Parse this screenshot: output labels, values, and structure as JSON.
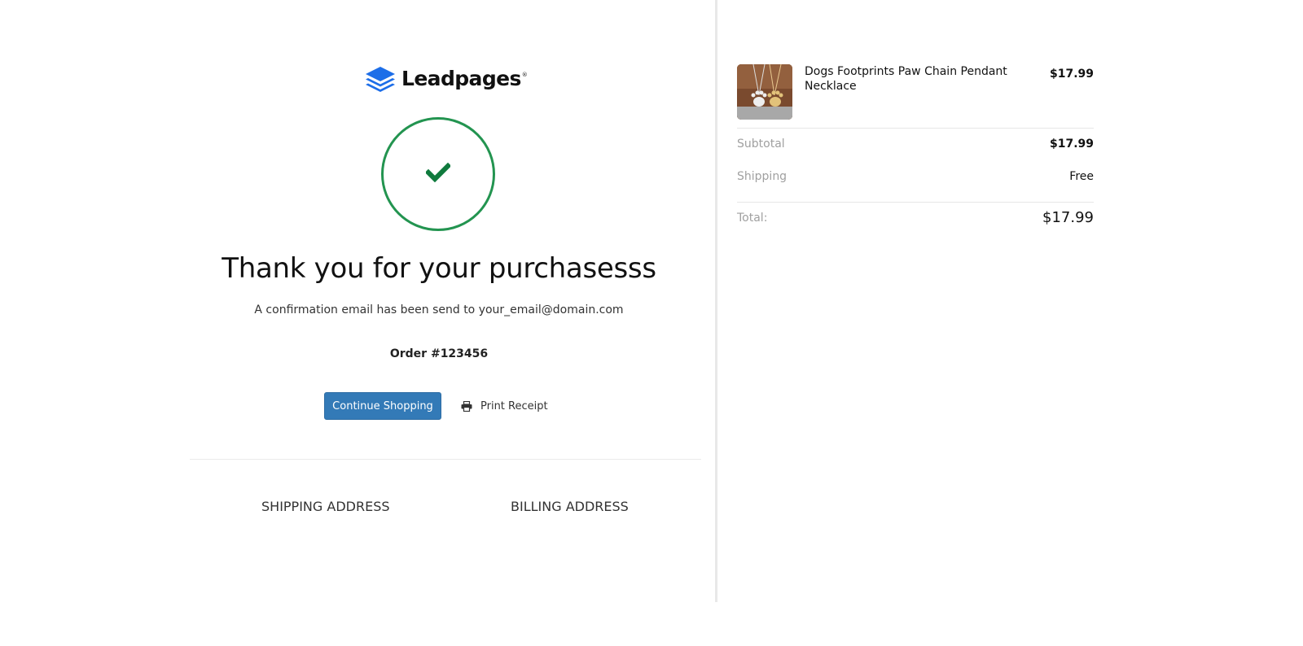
{
  "brand": {
    "name": "Leadpages",
    "registered_mark": "®",
    "color": "#1d6ee8"
  },
  "confirmation": {
    "status_color": "#239450",
    "title": "Thank you for your purchasesss",
    "message": "A confirmation email has been send to your_email@domain.com",
    "order_number": "Order #123456"
  },
  "actions": {
    "continue_label": "Continue Shopping",
    "print_label": "Print Receipt",
    "button_color": "#337ab7"
  },
  "addresses": {
    "shipping_heading": "SHIPPING ADDRESS",
    "billing_heading": "BILLING ADDRESS"
  },
  "order_summary": {
    "items": [
      {
        "name": "Dogs Footprints Paw Chain Pendant Necklace",
        "price": "$17.99",
        "image_icon": "paw-pendant-necklace-photo"
      }
    ],
    "subtotal_label": "Subtotal",
    "subtotal_value": "$17.99",
    "shipping_label": "Shipping",
    "shipping_value": "Free",
    "total_label": "Total:",
    "total_value": "$17.99"
  }
}
